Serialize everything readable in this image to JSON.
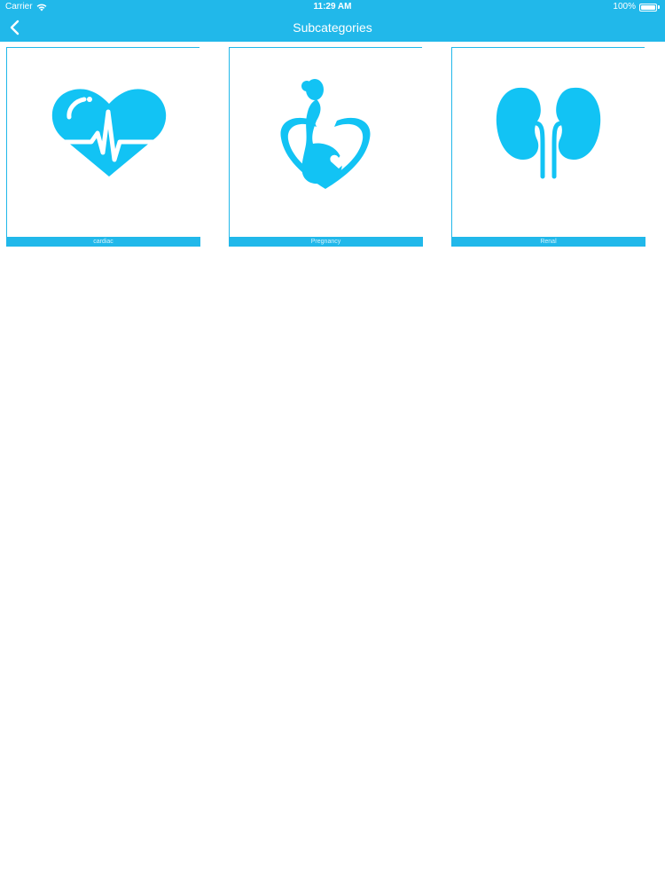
{
  "status_bar": {
    "carrier": "Carrier",
    "time": "11:29 AM",
    "battery": "100%",
    "battery_level": 1.0
  },
  "nav": {
    "title": "Subcategories"
  },
  "colors": {
    "accent": "#21b8ea",
    "icon": "#12c3f4"
  },
  "subcategories": [
    {
      "label": "cardiac",
      "icon": "heart-pulse-icon"
    },
    {
      "label": "Pregnancy",
      "icon": "pregnant-woman-icon"
    },
    {
      "label": "Renal",
      "icon": "kidneys-icon"
    }
  ]
}
